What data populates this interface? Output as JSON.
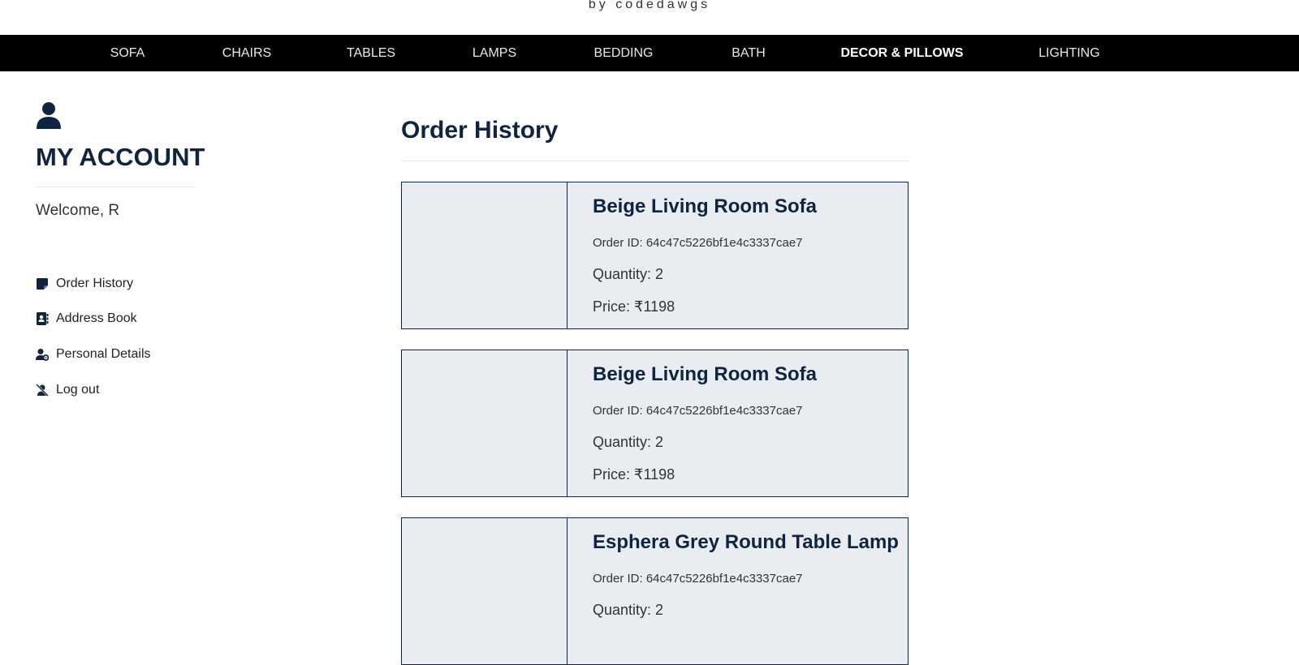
{
  "brand": {
    "tagline": "by codedawgs"
  },
  "nav": {
    "items": [
      {
        "label": "SOFA"
      },
      {
        "label": "CHAIRS"
      },
      {
        "label": "TABLES"
      },
      {
        "label": "LAMPS"
      },
      {
        "label": "BEDDING"
      },
      {
        "label": "BATH"
      },
      {
        "label": "DECOR & PILLOWS"
      },
      {
        "label": "LIGHTING"
      }
    ],
    "active": "DECOR & PILLOWS"
  },
  "sidebar": {
    "title": "MY ACCOUNT",
    "welcome": "Welcome, R",
    "items": [
      {
        "label": "Order History",
        "icon": "note-icon"
      },
      {
        "label": "Address Book",
        "icon": "address-book-icon"
      },
      {
        "label": "Personal Details",
        "icon": "user-gear-icon"
      },
      {
        "label": "Log out",
        "icon": "user-slash-icon"
      }
    ]
  },
  "main": {
    "title": "Order History",
    "orders": [
      {
        "name": "Beige Living Room Sofa",
        "order_id": "Order ID: 64c47c5226bf1e4c3337cae7",
        "quantity": "Quantity: 2",
        "price": "Price: ₹1198"
      },
      {
        "name": "Beige Living Room Sofa",
        "order_id": "Order ID: 64c47c5226bf1e4c3337cae7",
        "quantity": "Quantity: 2",
        "price": "Price: ₹1198"
      },
      {
        "name": "Esphera Grey Round Table Lamp",
        "order_id": "Order ID: 64c47c5226bf1e4c3337cae7",
        "quantity": "Quantity: 2",
        "price": ""
      }
    ]
  },
  "colors": {
    "navy": "#0f2440",
    "nav_bg": "#000000",
    "card_bg": "#e9ecf1"
  }
}
